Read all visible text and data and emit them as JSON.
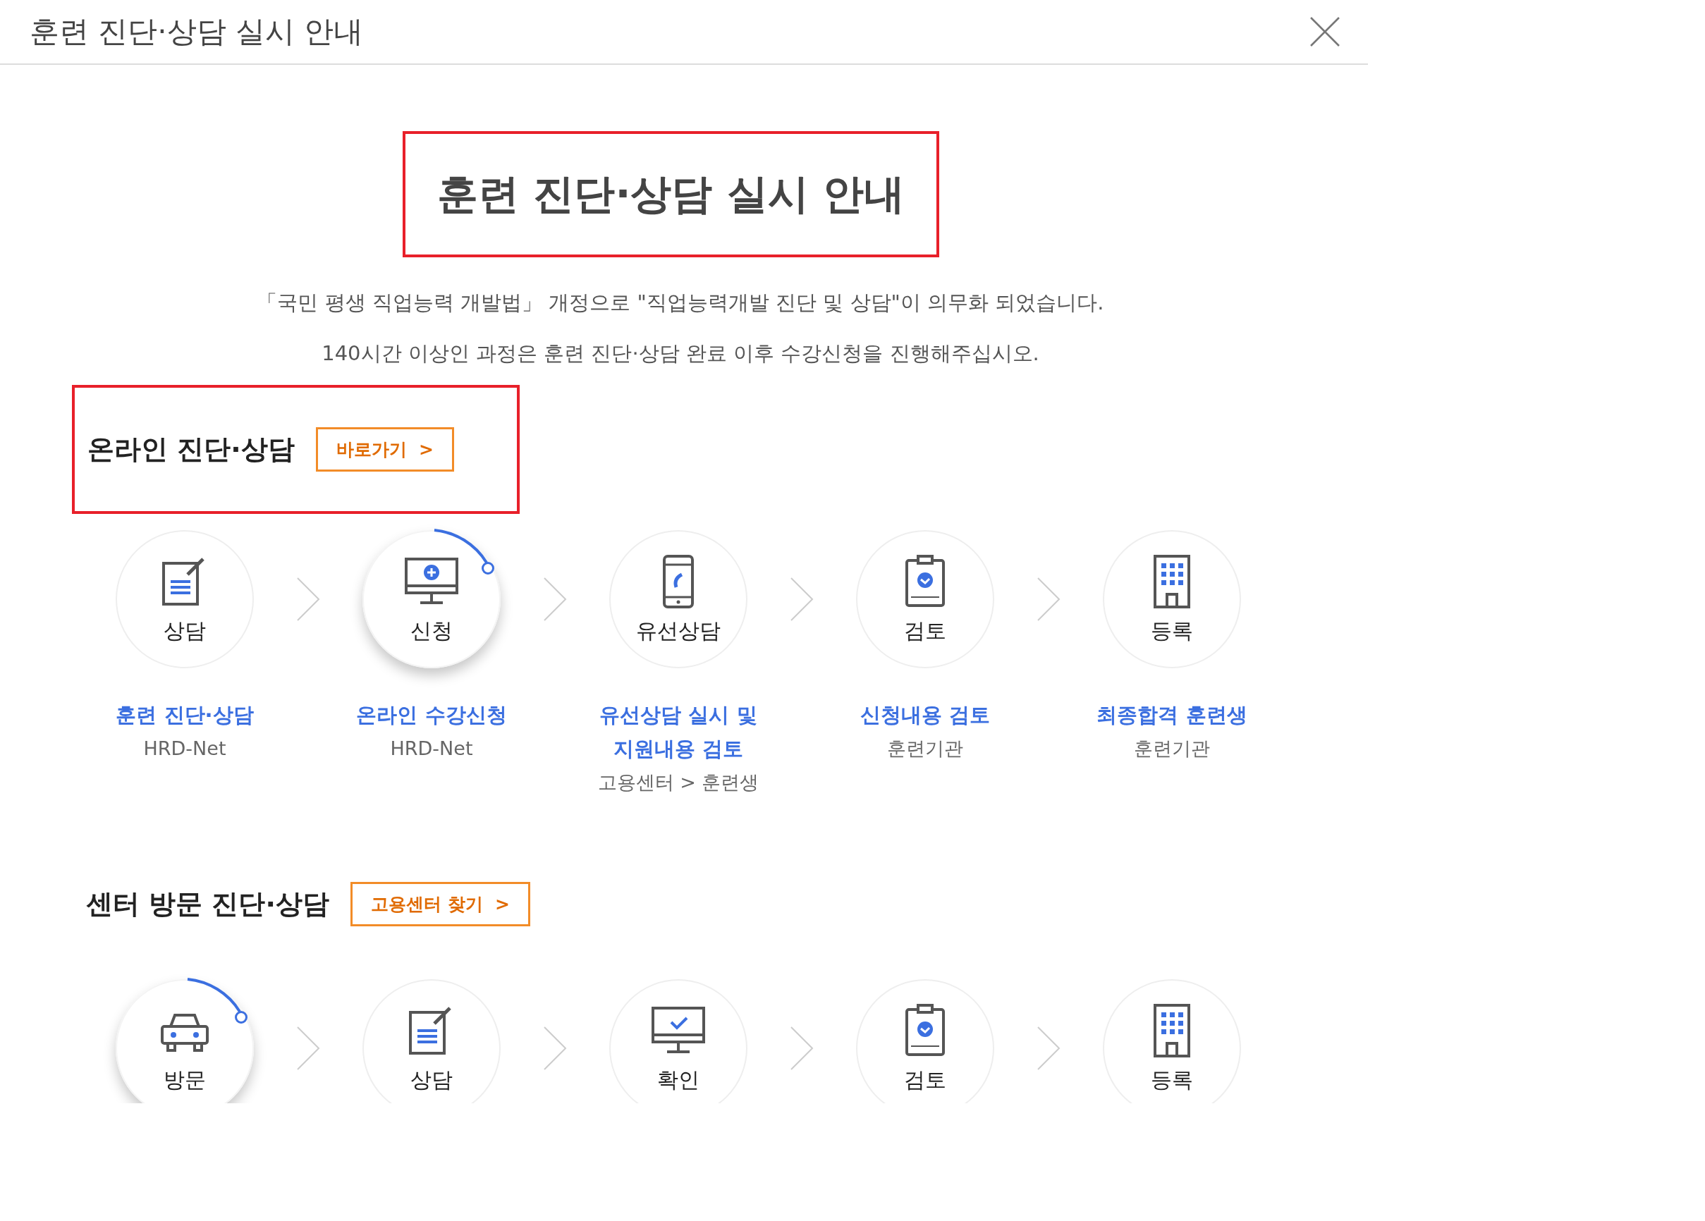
{
  "header": {
    "title": "훈련 진단·상담 실시 안내"
  },
  "main_title": "훈련 진단·상담 실시 안내",
  "intro": [
    "「국민 평생 직업능력 개발법」 개정으로 \"직업능력개발 진단 및 상담\"이 의무화 되었습니다.",
    "140시간 이상인 과정은 훈련 진단·상담 완료 이후 수강신청을 진행해주십시오."
  ],
  "sections": [
    {
      "title": "온라인 진단·상담",
      "highlighted": true,
      "button": "바로가기  >",
      "steps": [
        {
          "kind": "consult",
          "label": "상담",
          "active": false,
          "title_lines": [
            "훈련 진단·상담"
          ],
          "agent": "HRD-Net"
        },
        {
          "kind": "apply",
          "label": "신청",
          "active": true,
          "title_lines": [
            "온라인 수강신청"
          ],
          "agent": "HRD-Net"
        },
        {
          "kind": "call",
          "label": "유선상담",
          "active": false,
          "title_lines": [
            "유선상담 실시 및",
            "지원내용 검토"
          ],
          "agent": "고용센터 > 훈련생"
        },
        {
          "kind": "review",
          "label": "검토",
          "active": false,
          "title_lines": [
            "신청내용 검토"
          ],
          "agent": "훈련기관"
        },
        {
          "kind": "register",
          "label": "등록",
          "active": false,
          "title_lines": [
            "최종합격 훈련생"
          ],
          "agent": "훈련기관"
        }
      ]
    },
    {
      "title": "센터 방문 진단·상담",
      "highlighted": false,
      "button": "고용센터 찾기  >",
      "steps": [
        {
          "kind": "visit",
          "label": "방문",
          "active": true
        },
        {
          "kind": "consult",
          "label": "상담",
          "active": false
        },
        {
          "kind": "confirm",
          "label": "확인",
          "active": false
        },
        {
          "kind": "review",
          "label": "검토",
          "active": false
        },
        {
          "kind": "register",
          "label": "등록",
          "active": false
        }
      ]
    }
  ]
}
